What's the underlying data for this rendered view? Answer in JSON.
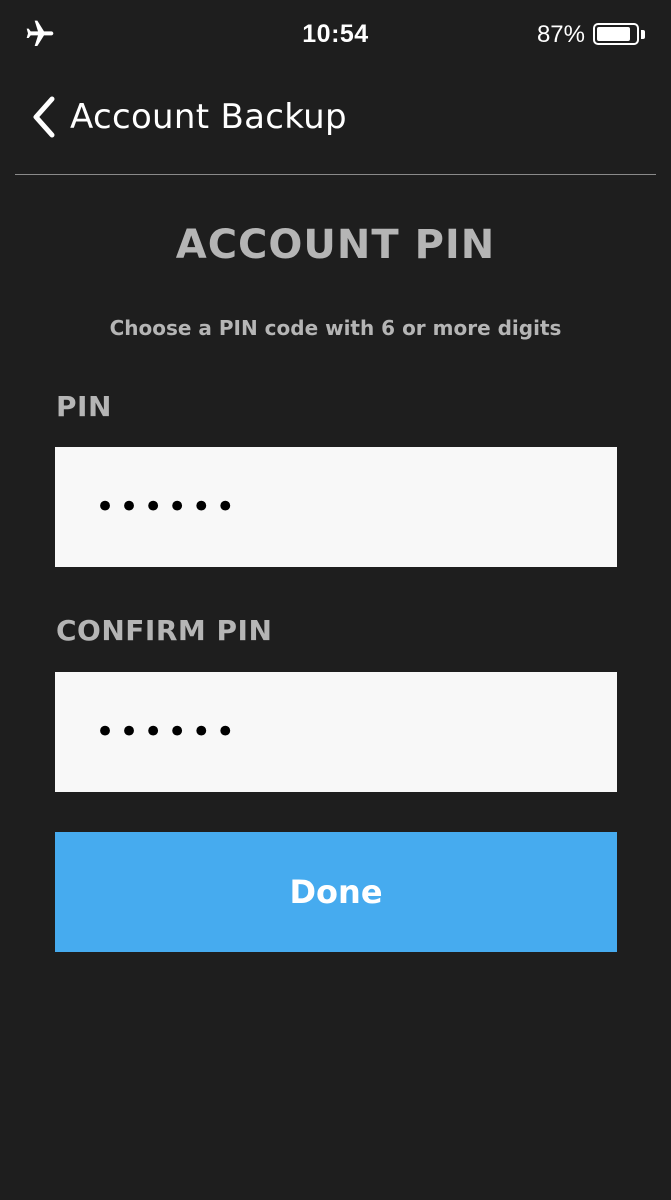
{
  "status_bar": {
    "time": "10:54",
    "battery_percent": "87%",
    "battery_level": 0.87,
    "left_icon": "airplane-icon"
  },
  "nav": {
    "back_icon": "chevron-left-icon",
    "title": "Account Backup"
  },
  "page": {
    "title": "ACCOUNT PIN",
    "subtitle": "Choose a PIN code with 6 or more digits"
  },
  "form": {
    "pin_label": "PIN",
    "pin_value": "••••••",
    "confirm_label": "CONFIRM PIN",
    "confirm_value": "••••••",
    "done_label": "Done"
  },
  "colors": {
    "background": "#1e1e1e",
    "accent": "#46abef",
    "label_text": "#b5b5b5",
    "input_background": "#f8f8f8"
  }
}
